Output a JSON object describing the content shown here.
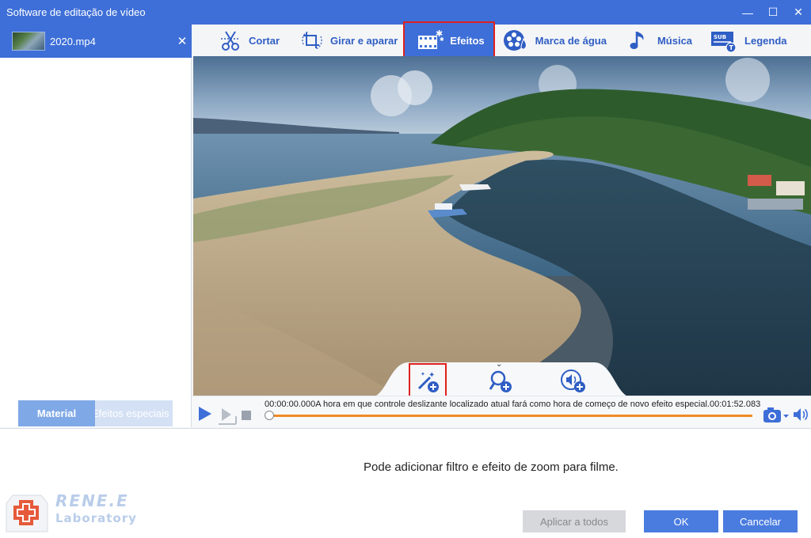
{
  "window": {
    "title": "Software de editação de vídeo",
    "minimize": "—",
    "maximize": "☐",
    "close": "✕"
  },
  "file_panel": {
    "file_name": "2020.mp4",
    "close": "✕",
    "tabs": [
      {
        "label": "Material",
        "active": true
      },
      {
        "label": "Efeitos especiais",
        "active": false
      }
    ]
  },
  "toolbar": {
    "items": [
      {
        "label": "Cortar",
        "icon": "scissors-icon"
      },
      {
        "label": "Girar e aparar",
        "icon": "rotate-crop-icon"
      },
      {
        "label": "Efeitos",
        "icon": "film-effects-icon",
        "active": true
      },
      {
        "label": "Marca de água",
        "icon": "film-reel-watermark-icon"
      },
      {
        "label": "Música",
        "icon": "music-note-icon"
      },
      {
        "label": "Legenda",
        "icon": "subtitle-icon"
      }
    ]
  },
  "effects_tray": {
    "buttons": [
      {
        "name": "add-filter",
        "icon": "magic-wand-add-icon"
      },
      {
        "name": "add-zoom",
        "icon": "zoom-add-icon"
      },
      {
        "name": "add-audio",
        "icon": "volume-add-icon"
      }
    ]
  },
  "playback": {
    "start_time": "00:00:00.000",
    "message": "A hora em que controle deslizante localizado atual fará como hora de começo de novo efeito especial.",
    "end_time": "00:01:52.083"
  },
  "bottom": {
    "hint": "Pode adicionar filtro e efeito de zoom para filme.",
    "apply_all": "Aplicar a todos",
    "ok": "OK",
    "cancel": "Cancelar"
  },
  "logo": {
    "line1": "RENE.E",
    "line2": "Laboratory"
  },
  "colors": {
    "accent": "#3e6fd8",
    "highlight": "#e02020",
    "timeline": "#f08a24"
  }
}
